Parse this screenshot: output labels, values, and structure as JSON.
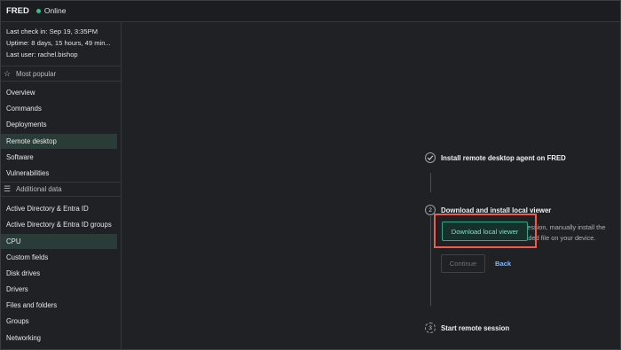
{
  "topbar": {
    "device_name": "FRED",
    "status": "Online"
  },
  "info": {
    "last_check_in_key": "Last check in:",
    "last_check_in_val": "Sep 19, 3:35PM",
    "uptime_key": "Uptime:",
    "uptime_val": "8 days, 15 hours, 49 min...",
    "last_user_key": "Last user:",
    "last_user_val": "rachel.bishop"
  },
  "sidebar": {
    "most_popular_label": "Most popular",
    "popular_items": [
      "Overview",
      "Commands",
      "Deployments",
      "Remote desktop",
      "Software",
      "Vulnerabilities"
    ],
    "additional_label": "Additional data",
    "additional_items": [
      "Active Directory & Entra ID",
      "Active Directory & Entra ID groups",
      "CPU",
      "Custom fields",
      "Disk drives",
      "Drivers",
      "Files and folders",
      "Groups",
      "Networking"
    ]
  },
  "stepper": {
    "step1_title": "Install remote desktop agent on FRED",
    "step2_number": "2",
    "step2_title": "Download and install local viewer",
    "step2_desc": "To be able to view a remote session, manually install the local viewer from the downloaded file on your device.",
    "download_label": "Download local viewer",
    "continue_label": "Continue",
    "back_label": "Back",
    "step3_number": "3",
    "step3_title": "Start remote session"
  },
  "icons": {
    "check": "check-icon",
    "star": "star-icon",
    "list": "list-icon"
  },
  "colors": {
    "accent": "#2fa884",
    "online": "#2fc28a",
    "highlight": "#f05a4a",
    "link": "#7fb8ff"
  }
}
